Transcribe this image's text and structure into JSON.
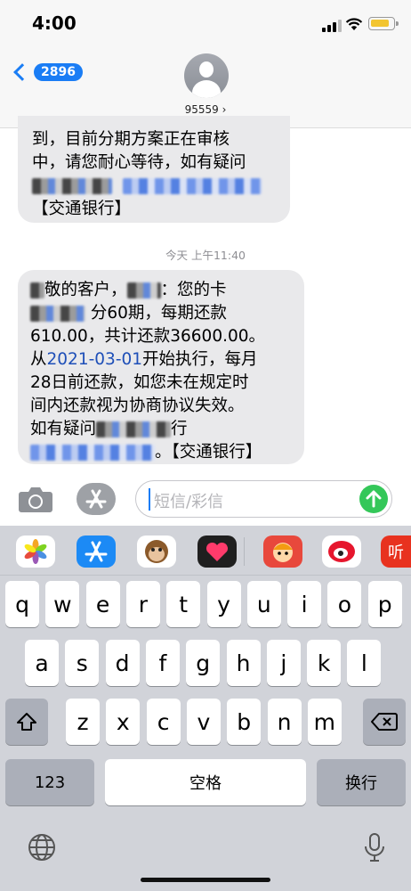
{
  "status_bar": {
    "time": "4:00"
  },
  "header": {
    "unread_count": "2896",
    "contact_number": "95559 ›"
  },
  "conversation": {
    "earlier_message_lines": [
      "到，目前分期方案正在审核",
      "中，请您耐心等待，如有疑问",
      "【交通银行】"
    ],
    "timestamp": "今天 上午11:40",
    "latest_message": {
      "l1_a": "敬的客户，",
      "l1_b": "：您的卡",
      "l2": "分60期，每期还款",
      "l3": "610.00，共计还款36600.00。",
      "l4_a": "从",
      "l4_link": "2021-03-01",
      "l4_b": "开始执行，每月",
      "l5": "28日前还款，如您未在规定时",
      "l6": "间内还款视为协商协议失效。",
      "l7_a": "如有疑问",
      "l7_b": "行",
      "l8_b": "。【交通银行】"
    }
  },
  "input": {
    "placeholder": "短信/彩信"
  },
  "app_strip": [
    "photos-app",
    "app-store",
    "animoji-monkey",
    "digital-touch",
    "sticker-app",
    "weibo-app",
    "music-app"
  ],
  "keyboard": {
    "row1": [
      "q",
      "w",
      "e",
      "r",
      "t",
      "y",
      "u",
      "i",
      "o",
      "p"
    ],
    "row2": [
      "a",
      "s",
      "d",
      "f",
      "g",
      "h",
      "j",
      "k",
      "l"
    ],
    "row3": [
      "z",
      "x",
      "c",
      "v",
      "b",
      "n",
      "m"
    ],
    "numbers_label": "123",
    "space_label": "空格",
    "return_label": "换行"
  },
  "colors": {
    "ios_blue": "#1a7df5",
    "send_green": "#34c759",
    "bubble_gray": "#e9e9eb"
  }
}
